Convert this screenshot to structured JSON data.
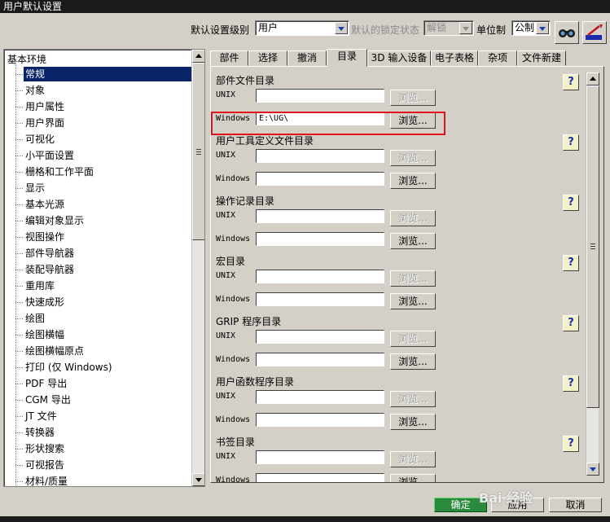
{
  "window": {
    "title": "用户默认设置"
  },
  "toolbar": {
    "level_label": "默认设置级别",
    "level_value": "用户",
    "lock_label": "默认的锁定状态",
    "lock_value": "解锁",
    "units_label": "单位制",
    "units_value": "公制"
  },
  "tree": {
    "root": "基本环境",
    "items": [
      "常规",
      "对象",
      "用户属性",
      "用户界面",
      "可视化",
      "小平面设置",
      "栅格和工作平面",
      "显示",
      "基本光源",
      "编辑对象显示",
      "视图操作",
      "部件导航器",
      "装配导航器",
      "重用库",
      "快速成形",
      "绘图",
      "绘图横幅",
      "绘图横幅原点",
      "打印 (仅 Windows)",
      "PDF 导出",
      "CGM 导出",
      "JT 文件",
      "转换器",
      "形状搜索",
      "可视报告",
      "材料/质量"
    ]
  },
  "tabs": [
    "部件",
    "选择",
    "撤消",
    "目录",
    "3D 输入设备",
    "电子表格",
    "杂项",
    "文件新建"
  ],
  "groups": [
    {
      "title": "部件文件目录",
      "unix_label": "UNIX",
      "windows_label": "Windows",
      "unix_value": "",
      "windows_value": "E:\\UG\\"
    },
    {
      "title": "用户工具定义文件目录",
      "unix_label": "UNIX",
      "windows_label": "Windows",
      "unix_value": "",
      "windows_value": ""
    },
    {
      "title": "操作记录目录",
      "unix_label": "UNIX",
      "windows_label": "Windows",
      "unix_value": "",
      "windows_value": ""
    },
    {
      "title": "宏目录",
      "unix_label": "UNIX",
      "windows_label": "Windows",
      "unix_value": "",
      "windows_value": ""
    },
    {
      "title": "GRIP 程序目录",
      "unix_label": "UNIX",
      "windows_label": "Windows",
      "unix_value": "",
      "windows_value": ""
    },
    {
      "title": "用户函数程序目录",
      "unix_label": "UNIX",
      "windows_label": "Windows",
      "unix_value": "",
      "windows_value": ""
    },
    {
      "title": "书签目录",
      "unix_label": "UNIX",
      "windows_label": "Windows",
      "unix_value": "",
      "windows_value": ""
    }
  ],
  "browse_label": "浏览...",
  "help_label": "?",
  "buttons": {
    "ok": "确定",
    "apply": "应用",
    "cancel": "取消"
  },
  "watermark": "Bai 经验",
  "colors": {
    "selection": "#0a246a",
    "highlight": "#e0141e",
    "ok_button": "#2a8a3c"
  }
}
